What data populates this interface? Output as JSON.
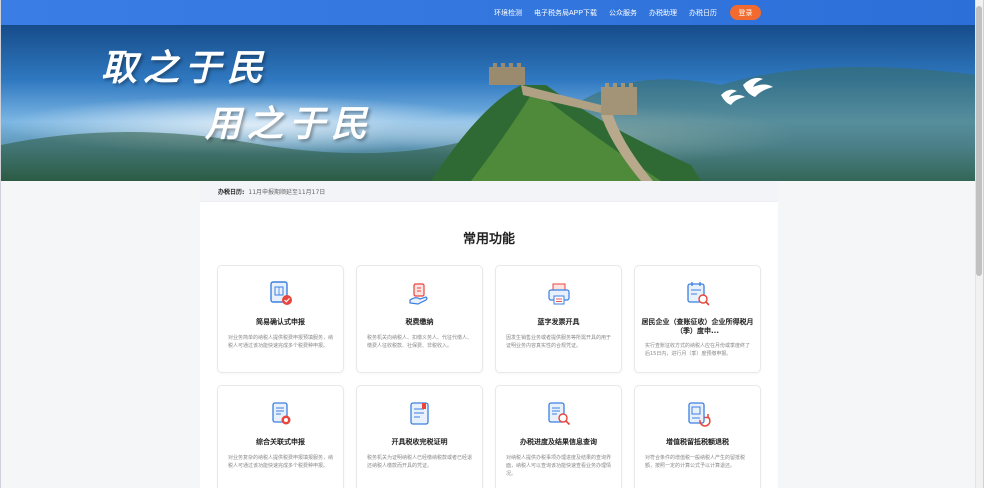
{
  "nav": {
    "items": [
      "环境检测",
      "电子税务局APP下载",
      "公众服务",
      "办税助理",
      "办税日历"
    ],
    "login_label": "登录"
  },
  "banner": {
    "line1": "取之于民",
    "line2": "用之于民"
  },
  "calendar": {
    "label": "办税日历:",
    "text": "11月申报期顺延至11月17日"
  },
  "section": {
    "title": "常用功能"
  },
  "cards": [
    {
      "title": "简易确认式申报",
      "desc": "对业务简单的纳税人提供税费申报预填服务，纳税人可通过该功能快速完成多个税费种申报。"
    },
    {
      "title": "税费缴纳",
      "desc": "税务机关向纳税人、扣缴义务人、代征代缴人、缴费人征收税款、社保费、非税收入。"
    },
    {
      "title": "蓝字发票开具",
      "desc": "因发生销售业务或者提供服务等所需开具的用于证明业务内容真实性的合规凭证。"
    },
    {
      "title": "居民企业（查账征收）企业所得税月（季）度申...",
      "desc": "实行查账征收方式的纳税人应在月份或季度终了后15日内，进行月（季）度预缴申报。"
    },
    {
      "title": "综合关联式申报",
      "desc": "对业务复杂的纳税人提供税费申报填报服务，纳税人可通过该功能快速完成多个税费种申报。"
    },
    {
      "title": "开具税收完税证明",
      "desc": "税务机关为证明纳税人已经缴纳税款或者已经退还纳税人缴款而开具的凭证。"
    },
    {
      "title": "办税进度及结果信息查询",
      "desc": "对纳税人提供办税事项办理进度及结果的查询界面，纳税人可以查询该功能快速查看业务办理情况。"
    },
    {
      "title": "增值税留抵税额退税",
      "desc": "对符合条件的增值税一般纳税人产生的留抵税额，按照一定的计算公式予以计算退还。"
    }
  ],
  "colors": {
    "topbar": "#2f74de",
    "accent": "#f26a2d",
    "icon_blue": "#3b7fe0",
    "icon_red": "#e8453c"
  }
}
